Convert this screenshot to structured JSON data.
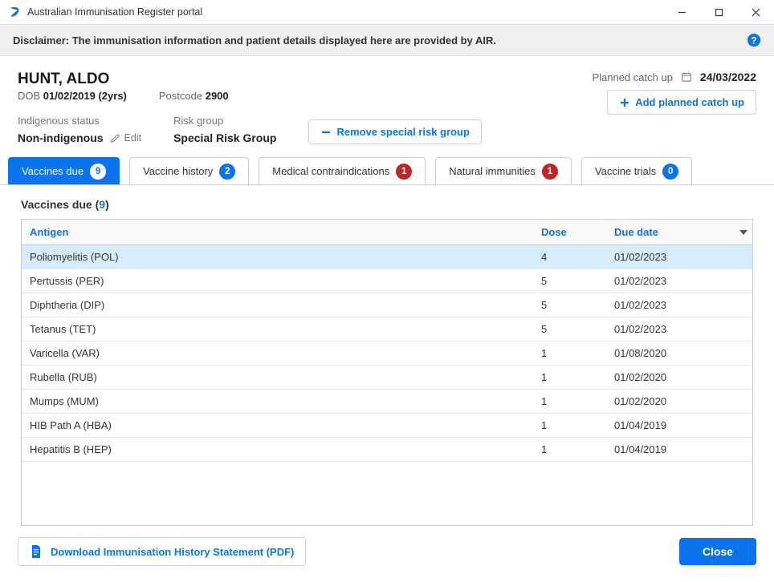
{
  "window": {
    "title": "Australian Immunisation Register portal"
  },
  "disclaimer": "Disclaimer: The immunisation information and patient details displayed here are provided by AIR.",
  "patient": {
    "name": "HUNT, ALDO",
    "dob_label": "DOB",
    "dob": "01/02/2019 (2yrs)",
    "postcode_label": "Postcode",
    "postcode": "2900",
    "indigenous_label": "Indigenous status",
    "indigenous_value": "Non-indigenous",
    "edit_label": "Edit",
    "risk_label": "Risk group",
    "risk_value": "Special Risk Group",
    "remove_risk_label": "Remove special risk group",
    "planned_label": "Planned catch up",
    "planned_date": "24/03/2022",
    "add_planned_label": "Add planned catch up"
  },
  "tabs": [
    {
      "label": "Vaccines due",
      "count": "9",
      "badge": "blue",
      "active": true
    },
    {
      "label": "Vaccine history",
      "count": "2",
      "badge": "blue",
      "active": false
    },
    {
      "label": "Medical contraindications",
      "count": "1",
      "badge": "red",
      "active": false
    },
    {
      "label": "Natural immunities",
      "count": "1",
      "badge": "red",
      "active": false
    },
    {
      "label": "Vaccine trials",
      "count": "0",
      "badge": "blue",
      "active": false
    }
  ],
  "section": {
    "title": "Vaccines due",
    "count": "9"
  },
  "table": {
    "columns": {
      "antigen": "Antigen",
      "dose": "Dose",
      "due": "Due date"
    },
    "rows": [
      {
        "antigen": "Poliomyelitis (POL)",
        "dose": "4",
        "due": "01/02/2023",
        "selected": true
      },
      {
        "antigen": "Pertussis (PER)",
        "dose": "5",
        "due": "01/02/2023"
      },
      {
        "antigen": "Diphtheria (DIP)",
        "dose": "5",
        "due": "01/02/2023"
      },
      {
        "antigen": "Tetanus (TET)",
        "dose": "5",
        "due": "01/02/2023"
      },
      {
        "antigen": "Varicella (VAR)",
        "dose": "1",
        "due": "01/08/2020"
      },
      {
        "antigen": "Rubella (RUB)",
        "dose": "1",
        "due": "01/02/2020"
      },
      {
        "antigen": "Mumps (MUM)",
        "dose": "1",
        "due": "01/02/2020"
      },
      {
        "antigen": "HIB Path A (HBA)",
        "dose": "1",
        "due": "01/04/2019"
      },
      {
        "antigen": "Hepatitis B (HEP)",
        "dose": "1",
        "due": "01/04/2019"
      }
    ]
  },
  "footer": {
    "download_label": "Download Immunisation History Statement (PDF)",
    "close_label": "Close"
  }
}
